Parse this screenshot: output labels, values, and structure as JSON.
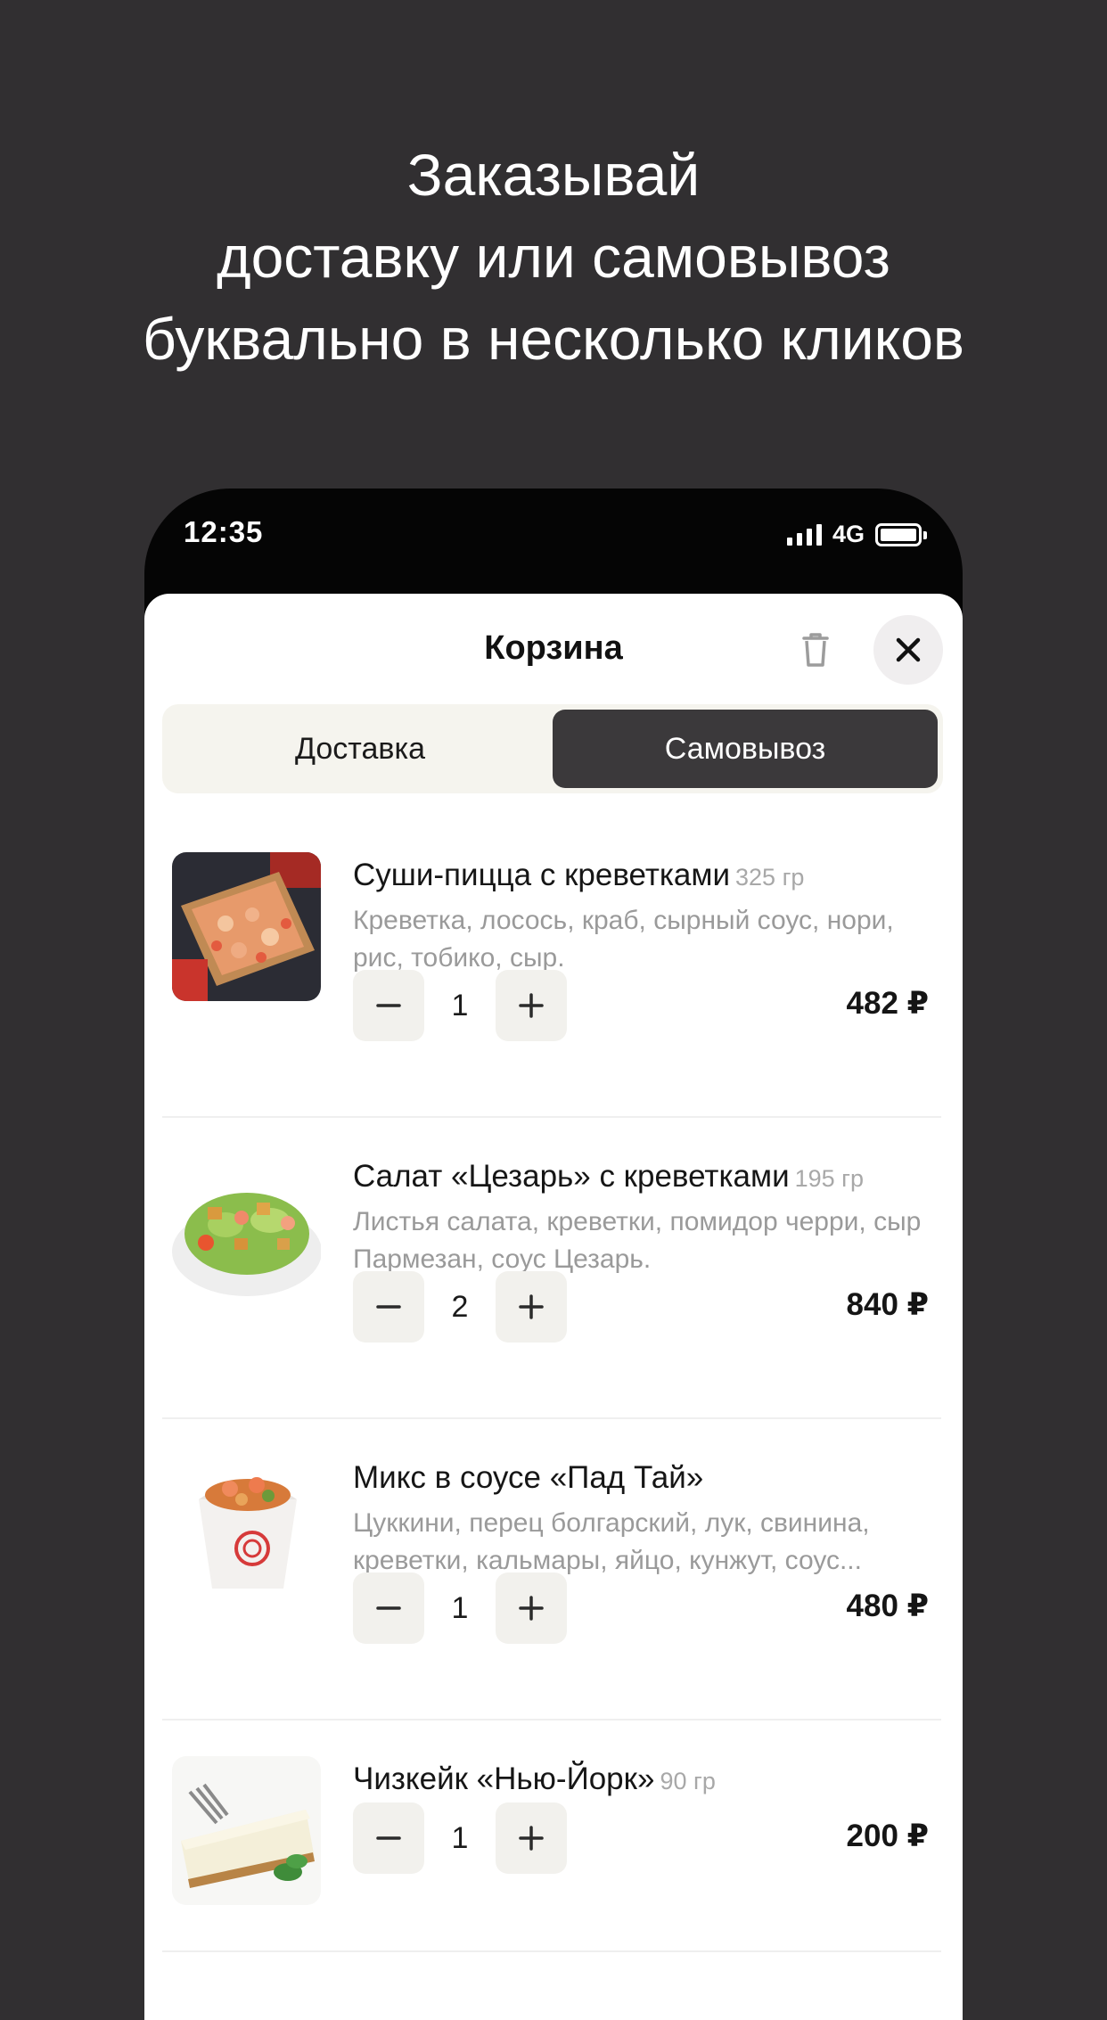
{
  "headline": {
    "line1": "Заказывай",
    "line2": "доставку или самовывоз",
    "line3": "буквально в несколько кликов"
  },
  "status_bar": {
    "time": "12:35",
    "network": "4G"
  },
  "cart": {
    "title": "Корзина",
    "tabs": [
      {
        "label": "Доставка",
        "active": false
      },
      {
        "label": "Самовывоз",
        "active": true
      }
    ],
    "items": [
      {
        "name": "Суши-пицца с креветками",
        "weight": "325 гр",
        "description": "Креветка, лосось, краб, сырный соус, нори, рис, тобико, сыр.",
        "quantity": "1",
        "price": "482 ₽"
      },
      {
        "name": "Салат «Цезарь» с креветками",
        "weight": "195 гр",
        "description": "Листья салата, креветки, помидор черри, сыр Пармезан, соус Цезарь.",
        "quantity": "2",
        "price": "840 ₽"
      },
      {
        "name": "Микс в соусе «Пад Тай»",
        "weight": "",
        "description": "Цуккини, перец болгарский, лук, свинина, креветки, кальмары, яйцо, кунжут, соус...",
        "quantity": "1",
        "price": "480 ₽"
      },
      {
        "name": "Чизкейк «Нью-Йорк»",
        "weight": "90 гр",
        "description": "",
        "quantity": "1",
        "price": "200 ₽"
      }
    ]
  }
}
